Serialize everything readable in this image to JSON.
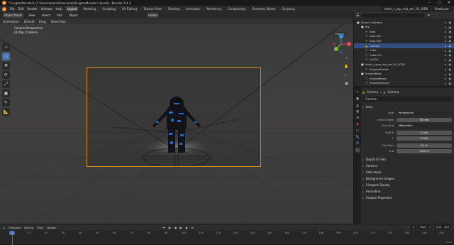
{
  "window": {
    "title": "* EnigmaMonster1 [C:\\Users\\okam\\Downloads\\EnigmaMonster1.blend] - Blender 4.4.3",
    "controls": [
      "–",
      "▢",
      "✕"
    ]
  },
  "menu": {
    "items": [
      "File",
      "Edit",
      "Render",
      "Window",
      "Help"
    ],
    "workspaces": [
      "Layout",
      "Modeling",
      "Sculpting",
      "UV Editing",
      "Texture Paint",
      "Shading",
      "Animation",
      "Rendering",
      "Compositing",
      "Geometry Nodes",
      "Scripting"
    ],
    "active_workspace": "Layout",
    "scene": "Inked_s_pup_mip_anl_10_LOD0",
    "view_layer": "ViewLayer"
  },
  "viewport": {
    "header": {
      "mode": "Object Mode",
      "view": "View",
      "select": "Select",
      "add": "Add",
      "object": "Object",
      "orientation": "Global",
      "options": "Options"
    },
    "tool_settings": {
      "orientation_label": "Orientation:",
      "orientation": "Default",
      "drag_label": "Drag:",
      "drag": "Select Box"
    },
    "overlay_line1": "Camera Perspective",
    "overlay_line2": "(0) Rig | Camera",
    "toolbar": [
      "⊹",
      "◌",
      "✥",
      "⟳",
      "⤢",
      "▣",
      "✎",
      "📐"
    ]
  },
  "outliner": {
    "search_placeholder": "",
    "rows": [
      {
        "label": "Scene Collection",
        "indent": 0,
        "icon": "collection",
        "color": "#ffffff"
      },
      {
        "label": "Rig",
        "indent": 1,
        "icon": "collection",
        "color": "#ffffff"
      },
      {
        "label": "Area",
        "indent": 2,
        "icon": "light",
        "color": "#e0a020"
      },
      {
        "label": "Area.001",
        "indent": 2,
        "icon": "light",
        "color": "#e0a020"
      },
      {
        "label": "Area.002",
        "indent": 2,
        "icon": "light",
        "color": "#e0a020"
      },
      {
        "label": "Camera",
        "indent": 2,
        "icon": "camera",
        "color": "#e0a020",
        "selected": true
      },
      {
        "label": "Cube",
        "indent": 2,
        "icon": "mesh",
        "color": "#e0a020"
      },
      {
        "label": "Cube.001",
        "indent": 2,
        "icon": "mesh",
        "color": "#e0a020"
      },
      {
        "label": "Cy.001",
        "indent": 2,
        "icon": "mesh",
        "color": "#e0a020"
      },
      {
        "label": "Inked_s_pup_mip_anl_10_LOD0",
        "indent": 1,
        "icon": "collection",
        "color": "#ffffff"
      },
      {
        "label": "EnigmaHelmet",
        "indent": 2,
        "icon": "mesh",
        "color": "#e0a020"
      },
      {
        "label": "EnigmaBody",
        "indent": 1,
        "icon": "collection",
        "color": "#ffffff"
      },
      {
        "label": "EnigmaBoots",
        "indent": 2,
        "icon": "mesh",
        "color": "#e0a020"
      },
      {
        "label": "EnigmaSleeve2",
        "indent": 2,
        "icon": "mesh",
        "color": "#e0a020"
      }
    ]
  },
  "properties": {
    "breadcrumb_object": "Camera",
    "breadcrumb_data": "Camera",
    "name": "Camera",
    "sections": {
      "lens": "Lens",
      "dof": "Depth of Field",
      "camera": "Camera",
      "safe_areas": "Safe Areas",
      "background": "Background Images",
      "viewport_display": "Viewport Display",
      "animation": "Animation",
      "custom": "Custom Properties"
    },
    "fields": [
      {
        "label": "Type",
        "value": "Perspective",
        "dropdown": true
      },
      {
        "label": "Focal Length",
        "value": "50 mm"
      },
      {
        "label": "Lens Unit",
        "value": "Millimeters",
        "dropdown": true
      },
      {
        "label": "Shift X",
        "value": "0.000"
      },
      {
        "label": "Y",
        "value": "0.000"
      },
      {
        "label": "Clip Start",
        "value": "0.1 m"
      },
      {
        "label": "End",
        "value": "1000 m"
      }
    ]
  },
  "timeline": {
    "header": {
      "playback": "Playback",
      "keying": "Keying",
      "view": "View",
      "marker": "Marker"
    },
    "current_frame": "1",
    "frame_field": "0",
    "start_label": "Start",
    "start": "1",
    "end_label": "End",
    "end": "250",
    "ticks": [
      "0",
      "10",
      "20",
      "30",
      "40",
      "50",
      "60",
      "70",
      "80",
      "90",
      "100",
      "110",
      "120",
      "130",
      "140",
      "150",
      "160",
      "170",
      "180",
      "190",
      "200",
      "210",
      "220",
      "230",
      "240",
      "250"
    ],
    "version": "4.4.3"
  },
  "colors": {
    "accent": "#4772b3",
    "camera_frame": "#d98d1f",
    "selection": "#334d80"
  }
}
